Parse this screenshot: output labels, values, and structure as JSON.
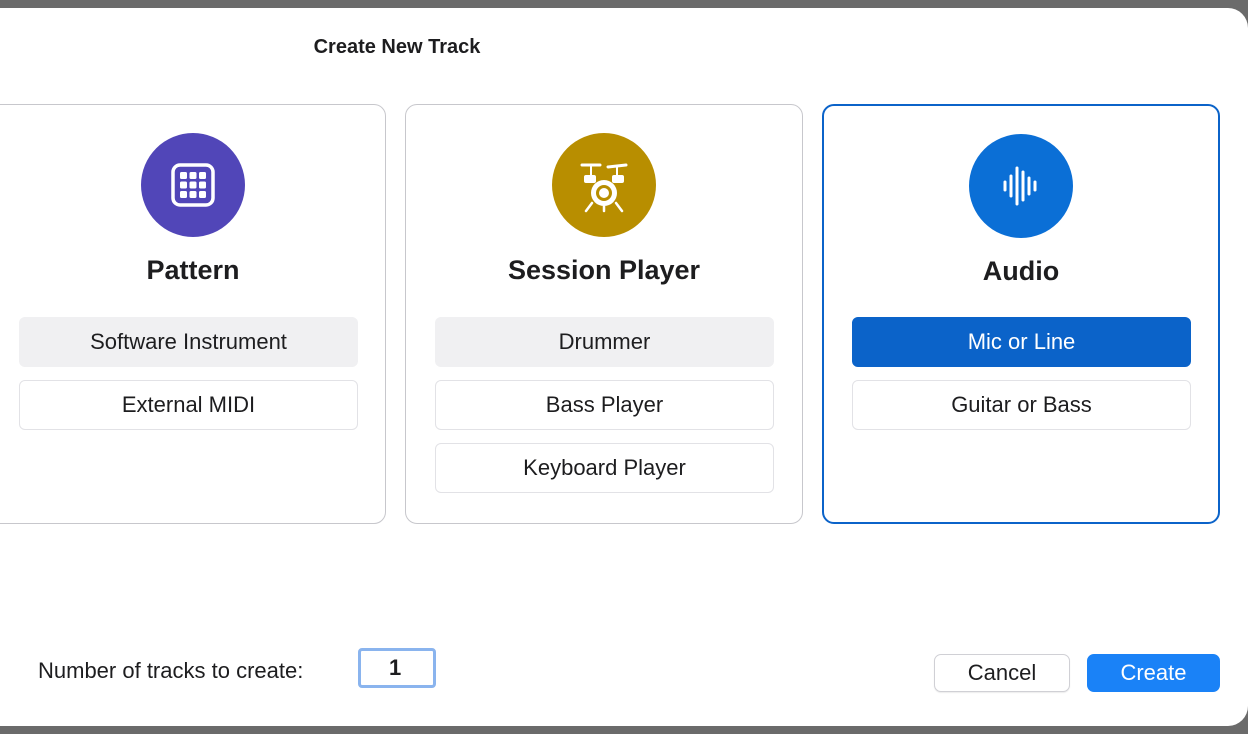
{
  "dialog": {
    "title": "Create New Track"
  },
  "cards": {
    "pattern": {
      "title": "Pattern",
      "icon": "grid-pads-icon",
      "color": "#5146b8",
      "options": [
        "Software Instrument",
        "External MIDI"
      ]
    },
    "session_player": {
      "title": "Session Player",
      "icon": "drum-kit-icon",
      "color": "#b88e00",
      "options": [
        "Drummer",
        "Bass Player",
        "Keyboard Player"
      ]
    },
    "audio": {
      "title": "Audio",
      "icon": "waveform-icon",
      "color": "#0b6fd6",
      "options": [
        "Mic or Line",
        "Guitar or Bass"
      ]
    }
  },
  "footer": {
    "count_label": "Number of tracks to create:",
    "count_value": "1",
    "cancel_label": "Cancel",
    "create_label": "Create"
  },
  "colors": {
    "accent": "#0b63c9",
    "create_button": "#1a82f7"
  }
}
